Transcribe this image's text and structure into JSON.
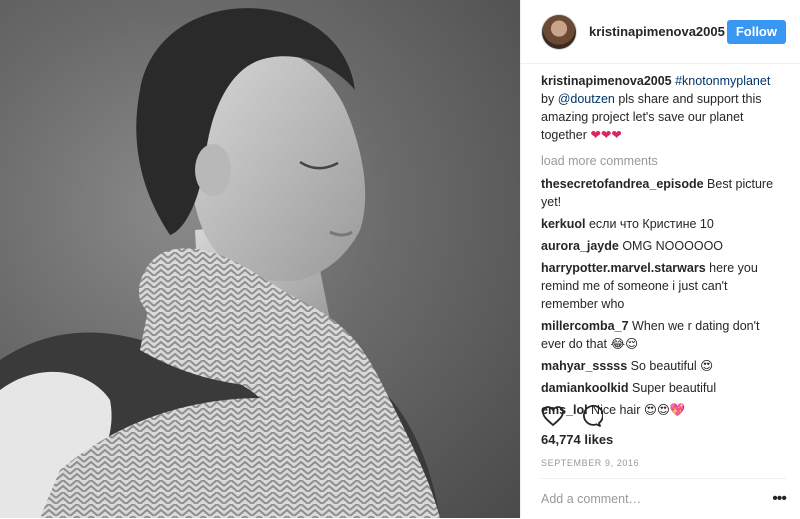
{
  "header": {
    "username": "kristinapimenova2005",
    "follow_label": "Follow"
  },
  "caption": {
    "username": "kristinapimenova2005",
    "hashtag": "#knotonmyplanet",
    "text_1": " by ",
    "mention": "@doutzen",
    "text_2": " pls share and support this amazing project let's save our planet together ",
    "emoji": "❤❤❤"
  },
  "load_more": "load more comments",
  "comments": [
    {
      "user": "thesecretofandrea_episode",
      "text": "Best picture yet!"
    },
    {
      "user": "kerkuol",
      "text": "если что Кристине 10"
    },
    {
      "user": "aurora_jayde",
      "text": "OMG NOOOOOO"
    },
    {
      "user": "harrypotter.marvel.starwars",
      "text": "here you remind me of someone i just can't remember who"
    },
    {
      "user": "millercomba_7",
      "text": "When we r dating don't ever do that 😂😌"
    },
    {
      "user": "mahyar_sssss",
      "text": "So beautiful 😍"
    },
    {
      "user": "damiankoolkid",
      "text": "Super beautiful"
    },
    {
      "user": "ems_lol",
      "text": "Nice hair 😍😍💖"
    }
  ],
  "likes": "64,774 likes",
  "date": "SEPTEMBER 9, 2016",
  "add_comment_placeholder": "Add a comment…",
  "more_glyph": "•••",
  "icons": {
    "like": "heart-icon",
    "comment": "comment-icon",
    "more": "more-options-icon"
  }
}
